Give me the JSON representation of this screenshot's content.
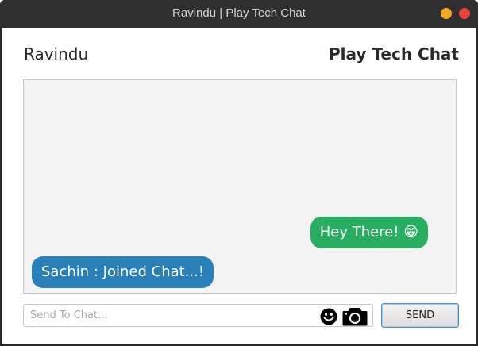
{
  "window": {
    "title": "Ravindu | Play Tech Chat"
  },
  "header": {
    "username": "Ravindu",
    "app_title": "Play Tech Chat"
  },
  "messages": [
    {
      "direction": "outgoing",
      "text": "Hey There! 😁",
      "color": "#27ae60"
    },
    {
      "direction": "incoming",
      "text": "Sachin : Joined Chat...!",
      "color": "#2980b9"
    }
  ],
  "composer": {
    "placeholder": "Send To Chat...",
    "value": "",
    "emoji_icon": "smiley-icon",
    "camera_icon": "camera-icon",
    "send_label": "SEND"
  }
}
